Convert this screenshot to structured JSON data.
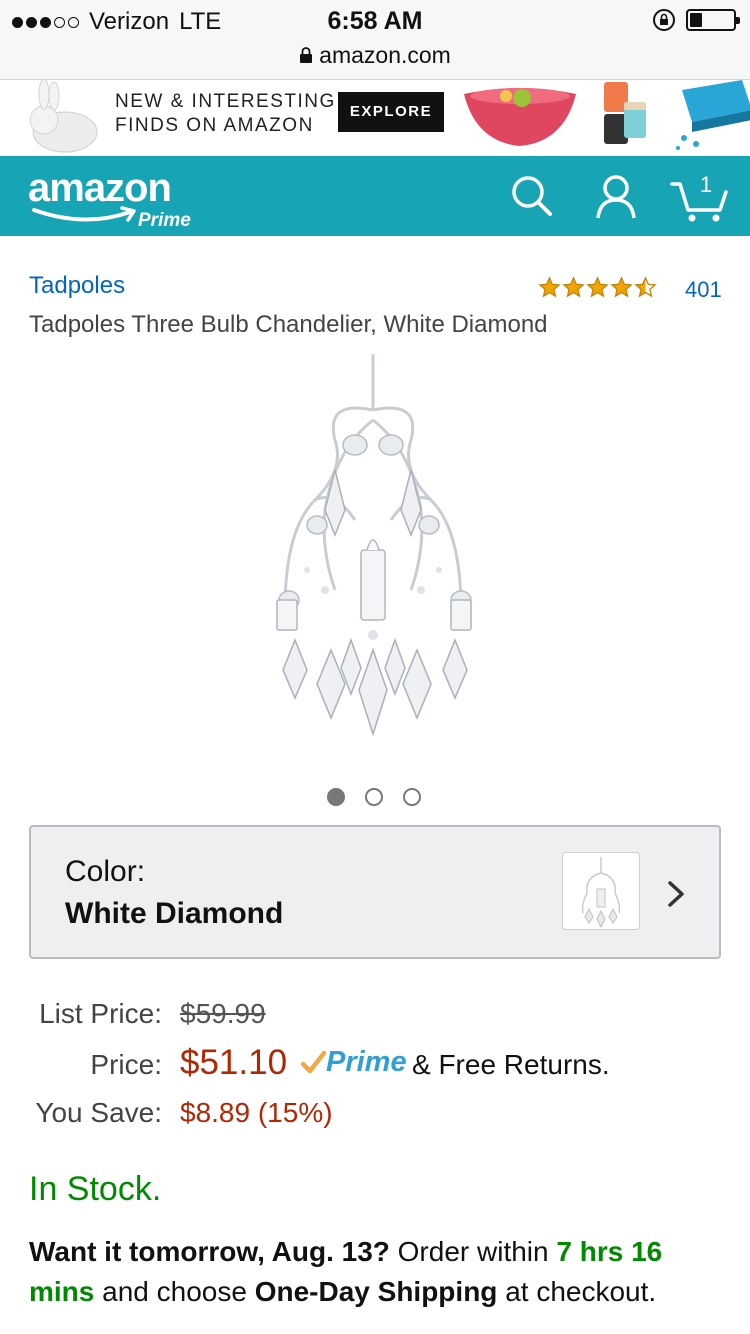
{
  "status_bar": {
    "carrier": "Verizon",
    "network": "LTE",
    "time": "6:58 AM",
    "url": "amazon.com",
    "signal_bars_filled": 3,
    "signal_bars_total": 5,
    "battery_level": 0.25
  },
  "promo": {
    "line1": "NEW & INTERESTING",
    "line2_bold": "FINDS",
    "line2_rest": " ON AMAZON",
    "button": "EXPLORE"
  },
  "header": {
    "logo": "amazon",
    "logo_sub": "Prime",
    "icons": [
      "search-icon",
      "account-icon",
      "cart-icon"
    ],
    "cart_count": "1",
    "color": "#17a5b6"
  },
  "product": {
    "brand": "Tadpoles",
    "title": "Tadpoles Three Bulb Chandelier, White Diamond",
    "rating": 4.5,
    "review_count": "401",
    "image_pages": 3,
    "active_image": 1,
    "color_label": "Color:",
    "color_value": "White Diamond"
  },
  "pricing": {
    "list_price_label": "List Price:",
    "list_price": "$59.99",
    "price_label": "Price:",
    "price": "$51.10",
    "prime_label": "Prime",
    "free_returns": "& Free Returns.",
    "you_save_label": "You Save:",
    "you_save": "$8.89 (15%)",
    "accent_red": "#b12704"
  },
  "availability": {
    "stock": "In Stock.",
    "stock_color": "#008a00",
    "want_it": "Want it tomorrow, Aug. 13?",
    "order_within": "Order within",
    "countdown": "7 hrs 16 mins",
    "and_choose": "and choose",
    "shipping": "One-Day Shipping",
    "at_checkout": "at checkout."
  }
}
